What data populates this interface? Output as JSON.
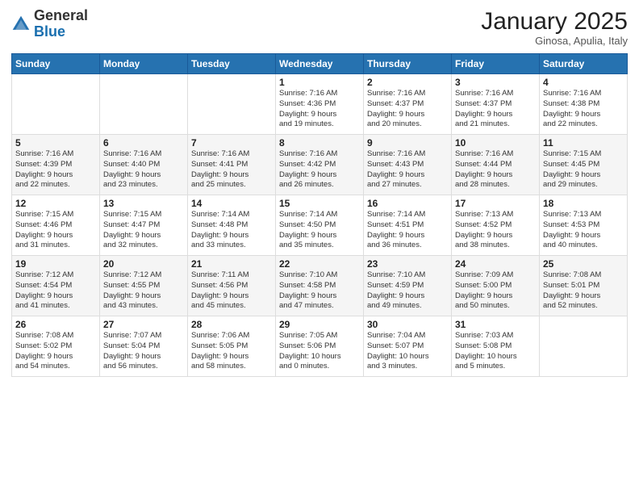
{
  "logo": {
    "general": "General",
    "blue": "Blue"
  },
  "header": {
    "month": "January 2025",
    "location": "Ginosa, Apulia, Italy"
  },
  "weekdays": [
    "Sunday",
    "Monday",
    "Tuesday",
    "Wednesday",
    "Thursday",
    "Friday",
    "Saturday"
  ],
  "weeks": [
    [
      {
        "day": "",
        "info": ""
      },
      {
        "day": "",
        "info": ""
      },
      {
        "day": "",
        "info": ""
      },
      {
        "day": "1",
        "info": "Sunrise: 7:16 AM\nSunset: 4:36 PM\nDaylight: 9 hours\nand 19 minutes."
      },
      {
        "day": "2",
        "info": "Sunrise: 7:16 AM\nSunset: 4:37 PM\nDaylight: 9 hours\nand 20 minutes."
      },
      {
        "day": "3",
        "info": "Sunrise: 7:16 AM\nSunset: 4:37 PM\nDaylight: 9 hours\nand 21 minutes."
      },
      {
        "day": "4",
        "info": "Sunrise: 7:16 AM\nSunset: 4:38 PM\nDaylight: 9 hours\nand 22 minutes."
      }
    ],
    [
      {
        "day": "5",
        "info": "Sunrise: 7:16 AM\nSunset: 4:39 PM\nDaylight: 9 hours\nand 22 minutes."
      },
      {
        "day": "6",
        "info": "Sunrise: 7:16 AM\nSunset: 4:40 PM\nDaylight: 9 hours\nand 23 minutes."
      },
      {
        "day": "7",
        "info": "Sunrise: 7:16 AM\nSunset: 4:41 PM\nDaylight: 9 hours\nand 25 minutes."
      },
      {
        "day": "8",
        "info": "Sunrise: 7:16 AM\nSunset: 4:42 PM\nDaylight: 9 hours\nand 26 minutes."
      },
      {
        "day": "9",
        "info": "Sunrise: 7:16 AM\nSunset: 4:43 PM\nDaylight: 9 hours\nand 27 minutes."
      },
      {
        "day": "10",
        "info": "Sunrise: 7:16 AM\nSunset: 4:44 PM\nDaylight: 9 hours\nand 28 minutes."
      },
      {
        "day": "11",
        "info": "Sunrise: 7:15 AM\nSunset: 4:45 PM\nDaylight: 9 hours\nand 29 minutes."
      }
    ],
    [
      {
        "day": "12",
        "info": "Sunrise: 7:15 AM\nSunset: 4:46 PM\nDaylight: 9 hours\nand 31 minutes."
      },
      {
        "day": "13",
        "info": "Sunrise: 7:15 AM\nSunset: 4:47 PM\nDaylight: 9 hours\nand 32 minutes."
      },
      {
        "day": "14",
        "info": "Sunrise: 7:14 AM\nSunset: 4:48 PM\nDaylight: 9 hours\nand 33 minutes."
      },
      {
        "day": "15",
        "info": "Sunrise: 7:14 AM\nSunset: 4:50 PM\nDaylight: 9 hours\nand 35 minutes."
      },
      {
        "day": "16",
        "info": "Sunrise: 7:14 AM\nSunset: 4:51 PM\nDaylight: 9 hours\nand 36 minutes."
      },
      {
        "day": "17",
        "info": "Sunrise: 7:13 AM\nSunset: 4:52 PM\nDaylight: 9 hours\nand 38 minutes."
      },
      {
        "day": "18",
        "info": "Sunrise: 7:13 AM\nSunset: 4:53 PM\nDaylight: 9 hours\nand 40 minutes."
      }
    ],
    [
      {
        "day": "19",
        "info": "Sunrise: 7:12 AM\nSunset: 4:54 PM\nDaylight: 9 hours\nand 41 minutes."
      },
      {
        "day": "20",
        "info": "Sunrise: 7:12 AM\nSunset: 4:55 PM\nDaylight: 9 hours\nand 43 minutes."
      },
      {
        "day": "21",
        "info": "Sunrise: 7:11 AM\nSunset: 4:56 PM\nDaylight: 9 hours\nand 45 minutes."
      },
      {
        "day": "22",
        "info": "Sunrise: 7:10 AM\nSunset: 4:58 PM\nDaylight: 9 hours\nand 47 minutes."
      },
      {
        "day": "23",
        "info": "Sunrise: 7:10 AM\nSunset: 4:59 PM\nDaylight: 9 hours\nand 49 minutes."
      },
      {
        "day": "24",
        "info": "Sunrise: 7:09 AM\nSunset: 5:00 PM\nDaylight: 9 hours\nand 50 minutes."
      },
      {
        "day": "25",
        "info": "Sunrise: 7:08 AM\nSunset: 5:01 PM\nDaylight: 9 hours\nand 52 minutes."
      }
    ],
    [
      {
        "day": "26",
        "info": "Sunrise: 7:08 AM\nSunset: 5:02 PM\nDaylight: 9 hours\nand 54 minutes."
      },
      {
        "day": "27",
        "info": "Sunrise: 7:07 AM\nSunset: 5:04 PM\nDaylight: 9 hours\nand 56 minutes."
      },
      {
        "day": "28",
        "info": "Sunrise: 7:06 AM\nSunset: 5:05 PM\nDaylight: 9 hours\nand 58 minutes."
      },
      {
        "day": "29",
        "info": "Sunrise: 7:05 AM\nSunset: 5:06 PM\nDaylight: 10 hours\nand 0 minutes."
      },
      {
        "day": "30",
        "info": "Sunrise: 7:04 AM\nSunset: 5:07 PM\nDaylight: 10 hours\nand 3 minutes."
      },
      {
        "day": "31",
        "info": "Sunrise: 7:03 AM\nSunset: 5:08 PM\nDaylight: 10 hours\nand 5 minutes."
      },
      {
        "day": "",
        "info": ""
      }
    ]
  ]
}
